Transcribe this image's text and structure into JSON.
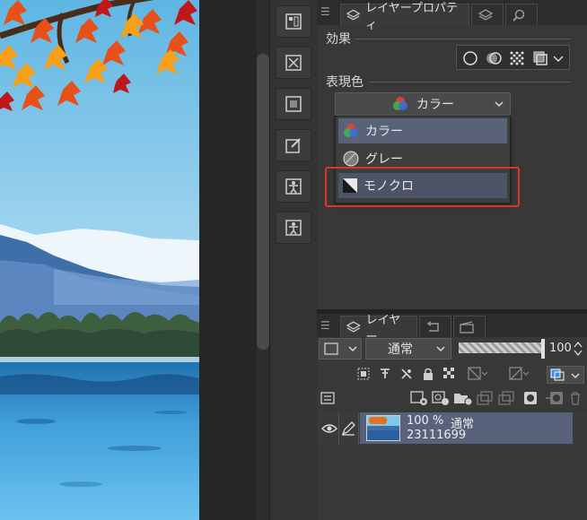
{
  "property_panel": {
    "tab_title": "レイヤープロパティ",
    "effect_label": "効果",
    "expression_label": "表現色",
    "selected_value": "カラー",
    "options": [
      {
        "label": "カラー",
        "icon": "color-circles-icon",
        "state": "selected"
      },
      {
        "label": "グレー",
        "icon": "gray-circle-icon",
        "state": "normal"
      },
      {
        "label": "モノクロ",
        "icon": "monochrome-square-icon",
        "state": "hovered"
      }
    ]
  },
  "layer_panel": {
    "tab_title": "レイヤー",
    "blend_mode": "通常",
    "opacity": "100",
    "layer": {
      "opacity_text": "100 %",
      "mode_text": "通常",
      "name": "23111699"
    }
  },
  "colors": {
    "highlight_box": "#e03030",
    "selected_row": "#5a6278",
    "layer_selected": "#58627a"
  }
}
